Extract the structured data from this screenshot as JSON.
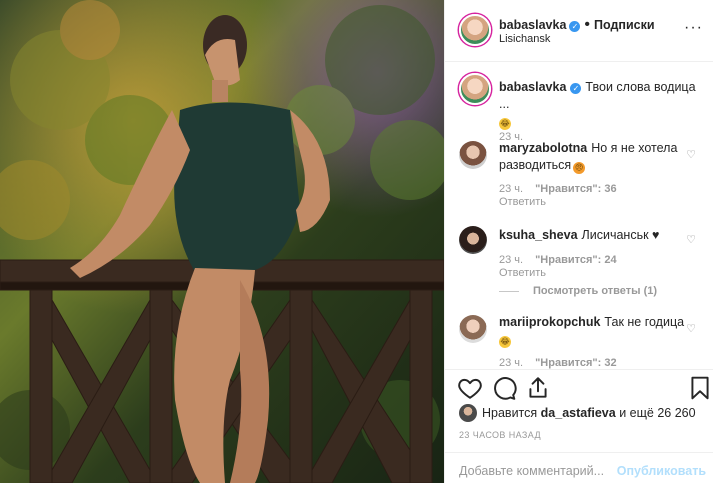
{
  "post": {
    "author": "babaslavka",
    "follow_label": "Подписки",
    "location": "Lisichansk",
    "separator": "•"
  },
  "caption": {
    "author": "babaslavka",
    "text": "Твои слова водица ...",
    "emoji": "😂",
    "time": "23 ч."
  },
  "comments": [
    {
      "user": "maryzabolotna",
      "text": "Но я не хотела разводиться",
      "emoji": "😠",
      "time": "23 ч.",
      "likes": "\"Нравится\": 36",
      "reply": "Ответить"
    },
    {
      "user": "ksuha_sheva",
      "text": "Лисичанськ ♥",
      "time": "23 ч.",
      "likes": "\"Нравится\": 24",
      "reply": "Ответить",
      "view_replies": "Посмотреть ответы (1)"
    },
    {
      "user": "mariiprokopchuk",
      "text": "Так не годица",
      "emoji": "😂",
      "time": "23 ч.",
      "likes": "\"Нравится\": 32"
    }
  ],
  "liked": {
    "prefix": "Нравится",
    "user": "da_astafieva",
    "suffix": "и ещё 26 260"
  },
  "timestamp": "23 ЧАСОВ НАЗАД",
  "add_comment": {
    "placeholder": "Добавьте комментарий...",
    "publish_label": "Опубликовать"
  },
  "icons": [
    "heart-icon",
    "comment-icon",
    "share-icon",
    "bookmark-icon",
    "more-options-icon",
    "verified-icon"
  ],
  "colors": {
    "verified": "#3897f0",
    "publish": "#b2dffc",
    "muted": "#999999"
  }
}
